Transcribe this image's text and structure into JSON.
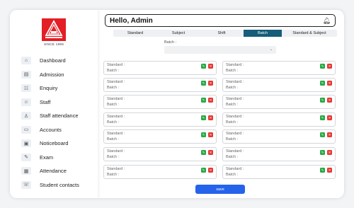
{
  "logo": {
    "caption": "SINCE 1999"
  },
  "header": {
    "greeting": "Hello, Admin"
  },
  "sidebar": {
    "items": [
      {
        "label": "Dashboard",
        "icon": "home-icon"
      },
      {
        "label": "Admission",
        "icon": "admission-icon"
      },
      {
        "label": "Enquiry",
        "icon": "enquiry-icon"
      },
      {
        "label": "Staff",
        "icon": "staff-icon"
      },
      {
        "label": "Staff attendance",
        "icon": "staff-attendance-icon"
      },
      {
        "label": "Accounts",
        "icon": "accounts-icon"
      },
      {
        "label": "Noticeboard",
        "icon": "noticeboard-icon"
      },
      {
        "label": "Exam",
        "icon": "exam-icon"
      },
      {
        "label": "Attendance",
        "icon": "attendance-icon"
      },
      {
        "label": "Student contacts",
        "icon": "contacts-icon"
      }
    ]
  },
  "tabs": [
    {
      "label": "Standard",
      "active": false
    },
    {
      "label": "Subject",
      "active": false
    },
    {
      "label": "Shift",
      "active": false
    },
    {
      "label": "Batch",
      "active": true
    },
    {
      "label": "Standard & Subject",
      "active": false
    }
  ],
  "batch_filter": {
    "label": "Batch :",
    "value": ""
  },
  "cards": [
    {
      "standard": "Standard :",
      "batch": "Batch :"
    },
    {
      "standard": "Standard :",
      "batch": "Batch :"
    },
    {
      "standard": "Standard :",
      "batch": "Batch :"
    },
    {
      "standard": "Standard :",
      "batch": "Batch :"
    },
    {
      "standard": "Standard :",
      "batch": "Batch :"
    },
    {
      "standard": "Standard :",
      "batch": "Batch :"
    },
    {
      "standard": "Standard :",
      "batch": "Batch :"
    },
    {
      "standard": "Standard :",
      "batch": "Batch :"
    },
    {
      "standard": "Standard :",
      "batch": "Batch :"
    },
    {
      "standard": "Standard :",
      "batch": "Batch :"
    },
    {
      "standard": "Standard :",
      "batch": "Batch :"
    },
    {
      "standard": "Standard :",
      "batch": "Batch :"
    },
    {
      "standard": "Standard :",
      "batch": "Batch :"
    },
    {
      "standard": "Standard :",
      "batch": "Batch :"
    }
  ],
  "save_label": "save",
  "colors": {
    "brand_red": "#e31e24",
    "active_tab": "#155d78",
    "save_button": "#2563eb",
    "edit": "#27a844",
    "delete": "#e53935"
  }
}
